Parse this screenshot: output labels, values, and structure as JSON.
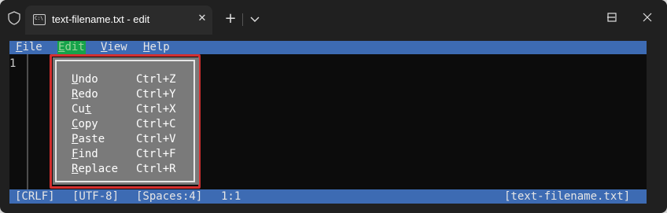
{
  "titlebar": {
    "tab_title": "text-filename.txt - edit",
    "tab_icon_text": "C:\\",
    "new_tab_label": "+",
    "close_tab_label": "✕"
  },
  "menubar": {
    "items": [
      {
        "pre": "",
        "key": "F",
        "post": "ile"
      },
      {
        "pre": "",
        "key": "E",
        "post": "dit"
      },
      {
        "pre": "",
        "key": "V",
        "post": "iew"
      },
      {
        "pre": "",
        "key": "H",
        "post": "elp"
      }
    ]
  },
  "editor": {
    "line_numbers": [
      "1"
    ]
  },
  "edit_menu": {
    "items": [
      {
        "pre": "",
        "key": "U",
        "post": "ndo",
        "shortcut": "Ctrl+Z"
      },
      {
        "pre": "",
        "key": "R",
        "post": "edo",
        "shortcut": "Ctrl+Y"
      },
      {
        "pre": "Cu",
        "key": "t",
        "post": "",
        "shortcut": "Ctrl+X"
      },
      {
        "pre": "",
        "key": "C",
        "post": "opy",
        "shortcut": "Ctrl+C"
      },
      {
        "pre": "",
        "key": "P",
        "post": "aste",
        "shortcut": "Ctrl+V"
      },
      {
        "pre": "",
        "key": "F",
        "post": "ind",
        "shortcut": "Ctrl+F"
      },
      {
        "pre": "",
        "key": "R",
        "post": "eplace",
        "shortcut": "Ctrl+R"
      }
    ]
  },
  "statusbar": {
    "line_ending": "[CRLF]",
    "encoding": "[UTF-8]",
    "indent": "[Spaces:4]",
    "position": "1:1",
    "filename": "[text-filename.txt]"
  },
  "colors": {
    "bar_blue": "#3d6bb3",
    "active_menu_green": "#16a34a",
    "highlight_red": "#d32f2f",
    "menu_gray": "#7a7a7a"
  }
}
